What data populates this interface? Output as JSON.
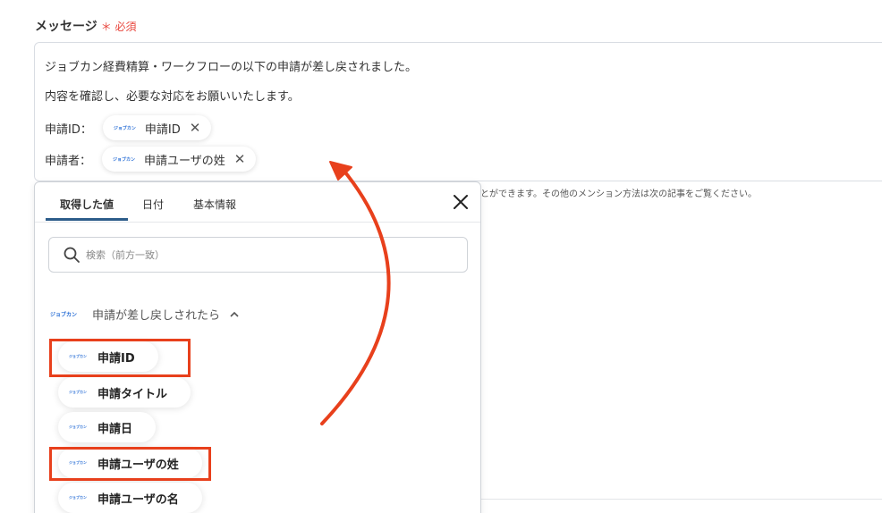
{
  "field": {
    "label": "メッセージ",
    "required_mark": "＊ 必須"
  },
  "message": {
    "line1": "ジョブカン経費精算・ワークフローの以下の申請が差し戻されました。",
    "line2": "内容を確認し、必要な対応をお願いいたします。",
    "rows": [
      {
        "label": "申請ID：",
        "chip_logo": "ジョブカン",
        "chip": "申請ID"
      },
      {
        "label": "申請者：",
        "chip_logo": "ジョブカン",
        "chip": "申請ユーザの姓"
      }
    ],
    "chip_close_glyph": "✕"
  },
  "hint": "とができます。その他のメンション方法は次の記事をご覧ください。",
  "popup": {
    "tabs": [
      "取得した値",
      "日付",
      "基本情報"
    ],
    "active_tab": 0,
    "search_placeholder": "検索（前方一致）",
    "group": {
      "logo": "ジョブカン",
      "title": "申請が差し戻しされたら",
      "expanded": true
    },
    "items": [
      {
        "logo": "ジョブカン",
        "label": "申請ID",
        "highlighted": true
      },
      {
        "logo": "ジョブカン",
        "label": "申請タイトル",
        "highlighted": false
      },
      {
        "logo": "ジョブカン",
        "label": "申請日",
        "highlighted": false
      },
      {
        "logo": "ジョブカン",
        "label": "申請ユーザの姓",
        "highlighted": true
      },
      {
        "logo": "ジョブカン",
        "label": "申請ユーザの名",
        "highlighted": false
      }
    ]
  },
  "colors": {
    "highlight": "#e8401c",
    "arrow": "#e8401c",
    "tab_accent": "#2c5c8a",
    "logo": "#2a6fd6"
  },
  "icons": [
    "close-icon",
    "search-icon",
    "chevron-up-icon",
    "jobcan-logo-icon"
  ]
}
